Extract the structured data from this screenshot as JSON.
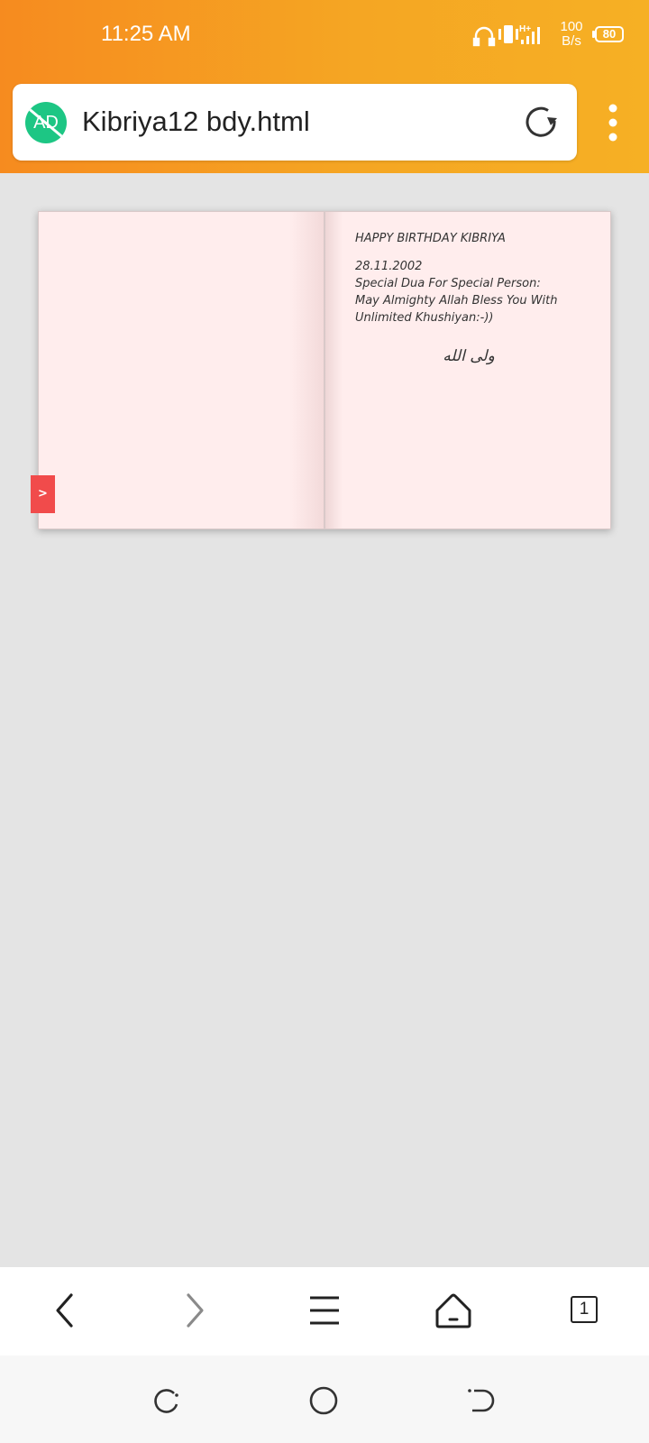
{
  "status_bar": {
    "time": "11:25 AM",
    "speed_value": "100",
    "speed_unit": "B/s",
    "battery": "80",
    "network_label": "H+"
  },
  "url_bar": {
    "adblock_label": "AD",
    "title": "Kibriya12 bdy.html"
  },
  "card": {
    "title": "HAPPY BIRTHDAY KIBRIYA",
    "date": "28.11.2002",
    "line1": "Special Dua For Special Person:",
    "line2": "May Almighty Allah Bless You With",
    "line3": "Unlimited Khushiyan:-))",
    "signature": "ولی الله",
    "next_label": ">"
  },
  "toolbar": {
    "tab_count": "1"
  },
  "colors": {
    "header_start": "#f68b1f",
    "header_end": "#f6b024",
    "adblock": "#1dc684",
    "page_bg": "#ffeded",
    "flip_tab": "#f14b4b",
    "content_bg": "#e4e4e4"
  },
  "icons": [
    "headphones-icon",
    "vibrate-icon",
    "signal-icon",
    "reload-icon",
    "more-vertical-icon",
    "back-icon",
    "forward-icon",
    "menu-icon",
    "home-icon",
    "tabs-icon",
    "recents-icon",
    "home-circle-icon",
    "system-back-icon"
  ]
}
